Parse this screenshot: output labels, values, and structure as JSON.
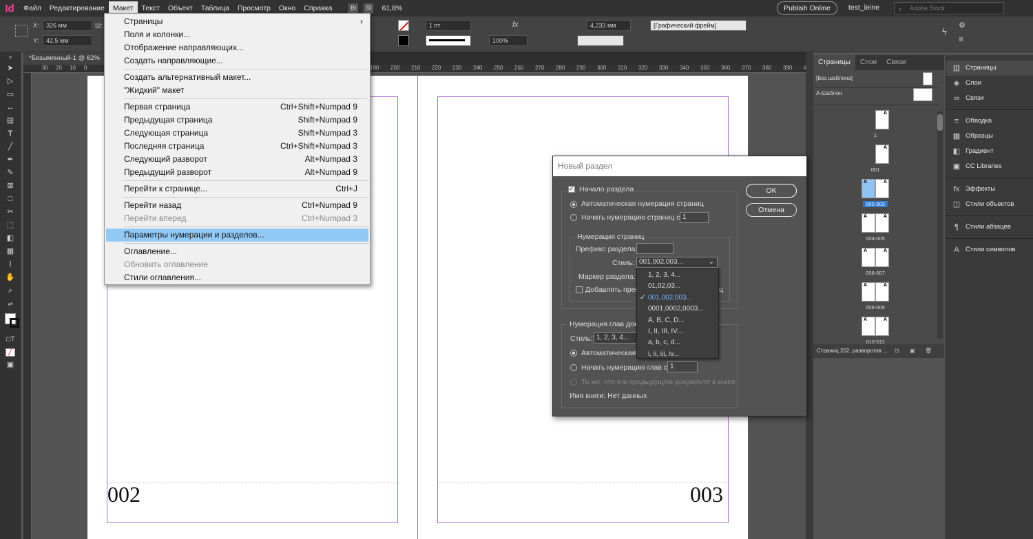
{
  "app": {
    "logo": "Id"
  },
  "menubar": {
    "items": [
      "Файл",
      "Редактирование",
      "Макет",
      "Текст",
      "Объект",
      "Таблица",
      "Просмотр",
      "Окно",
      "Справка"
    ],
    "bridge": "Br",
    "stock": "St",
    "zoom": "61,8%",
    "publish": "Publish Online",
    "user": "test_leine",
    "search_placeholder": "Adobe Stock"
  },
  "control": {
    "x_label": "X:",
    "x_value": "326 мм",
    "y_label": "Y:",
    "y_value": "42,5 мм",
    "w_label": "Ш:",
    "stroke": "1 пт",
    "scale": "100%",
    "size": "4,233 мм",
    "frame": "[Графический фрейм]"
  },
  "doc_tab": "*Безымянный-1 @ 62%",
  "ruler": [
    "30",
    "20",
    "10",
    "0",
    "190",
    "200",
    "210",
    "220",
    "230",
    "240",
    "250",
    "260",
    "270",
    "280",
    "290",
    "300",
    "310",
    "320",
    "330",
    "340",
    "350",
    "360",
    "370",
    "380",
    "390",
    "400",
    "410",
    "420"
  ],
  "pages": {
    "left_number": "002",
    "right_number": "003"
  },
  "menu": [
    {
      "label": "Страницы",
      "shortcut": "",
      "submenu": true
    },
    {
      "label": "Поля и колонки...",
      "shortcut": ""
    },
    {
      "label": "Отображение направляющих...",
      "shortcut": ""
    },
    {
      "label": "Создать направляющие...",
      "shortcut": ""
    },
    {
      "sep": true
    },
    {
      "label": "Создать альтернативный макет...",
      "shortcut": ""
    },
    {
      "label": "\"Жидкий\" макет",
      "shortcut": ""
    },
    {
      "sep": true
    },
    {
      "label": "Первая страница",
      "shortcut": "Ctrl+Shift+Numpad 9"
    },
    {
      "label": "Предыдущая страница",
      "shortcut": "Shift+Numpad 9"
    },
    {
      "label": "Следующая страница",
      "shortcut": "Shift+Numpad 3"
    },
    {
      "label": "Последняя страница",
      "shortcut": "Ctrl+Shift+Numpad 3"
    },
    {
      "label": "Следующий разворот",
      "shortcut": "Alt+Numpad 3"
    },
    {
      "label": "Предыдущий разворот",
      "shortcut": "Alt+Numpad 9"
    },
    {
      "sep": true
    },
    {
      "label": "Перейти к странице...",
      "shortcut": "Ctrl+J"
    },
    {
      "sep": true
    },
    {
      "label": "Перейти назад",
      "shortcut": "Ctrl+Numpad 9"
    },
    {
      "label": "Перейти вперед",
      "shortcut": "Ctrl+Numpad 3",
      "disabled": true
    },
    {
      "sep": true
    },
    {
      "label": "Параметры нумерации и разделов...",
      "shortcut": "",
      "highlighted": true
    },
    {
      "sep": true
    },
    {
      "label": "Оглавление...",
      "shortcut": ""
    },
    {
      "label": "Обновить оглавление",
      "shortcut": "",
      "disabled": true
    },
    {
      "label": "Стили оглавления...",
      "shortcut": ""
    }
  ],
  "dialog": {
    "title": "Новый раздел",
    "section_start": "Начало раздела",
    "auto_numbering": "Автоматическая нумерация страниц",
    "start_at": "Начать нумерацию страниц с:",
    "start_value": "1",
    "page_numbering_group": "Нумерация страниц",
    "prefix_label": "Префикс раздела:",
    "style_label": "Стиль:",
    "style_value": "001,002,003...",
    "marker_label": "Маркер раздела:",
    "add_prefix_partial": "Добавлять преф",
    "add_prefix_tail": "ц",
    "chapter_group": "Нумерация глав доку",
    "chapter_style_label": "Стиль:",
    "chapter_style_value": "1, 2, 3, 4...",
    "chapter_auto": "Автоматическая н",
    "chapter_start": "Начать нумерацию глав с:",
    "chapter_start_value": "1",
    "same_as_prev": "То же, что и в предыдущем документе в книге",
    "book_name": "Имя книги: Нет данных",
    "ok": "OK",
    "cancel": "Отмена",
    "style_options": [
      "1, 2, 3, 4...",
      "01,02,03...",
      "001,002,003...",
      "0001,0002,0003...",
      "A, B, C, D...",
      "I, II, III, IV...",
      "a, b, c, d...",
      "i, ii, iii, iv..."
    ],
    "selected_option": 2
  },
  "pages_panel": {
    "tabs": [
      "Страницы",
      "Слои",
      "Связи"
    ],
    "none_master": "[Без шаблона]",
    "a_master": "А-Шаблон",
    "labels": [
      "1",
      "001",
      "002-003",
      "004-005",
      "006-007",
      "008-009",
      "010-011"
    ],
    "status": "Страниц 202, разворотов ..."
  },
  "dock": {
    "group1": [
      {
        "icon": "pages-icon",
        "label": "Страницы"
      },
      {
        "icon": "layers-icon",
        "label": "Слои"
      },
      {
        "icon": "links-icon",
        "label": "Связи"
      }
    ],
    "group2": [
      {
        "icon": "stroke-icon",
        "label": "Обводка"
      },
      {
        "icon": "swatches-icon",
        "label": "Образцы"
      },
      {
        "icon": "gradient-icon",
        "label": "Градиент"
      },
      {
        "icon": "cc-libraries-icon",
        "label": "CC Libraries"
      }
    ],
    "group3": [
      {
        "icon": "effects-icon",
        "label": "Эффекты"
      },
      {
        "icon": "object-styles-icon",
        "label": "Стили объектов"
      }
    ],
    "group4": [
      {
        "icon": "paragraph-styles-icon",
        "label": "Стили абзацев"
      }
    ],
    "group5": [
      {
        "icon": "character-styles-icon",
        "label": "Стили символов"
      }
    ]
  }
}
